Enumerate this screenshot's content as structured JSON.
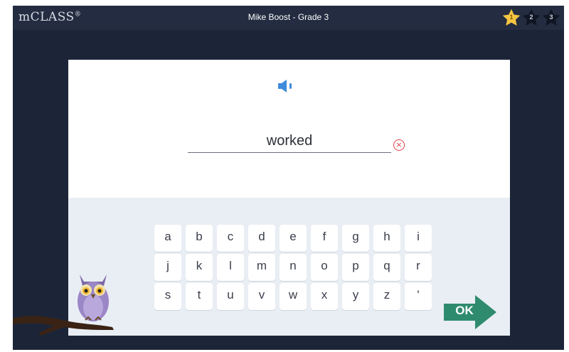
{
  "app": {
    "logo": "mCLASS",
    "logo_mark": "®",
    "title": "Mike Boost - Grade 3"
  },
  "stars": [
    {
      "number": "1",
      "earned": true
    },
    {
      "number": "2",
      "earned": false
    },
    {
      "number": "3",
      "earned": false
    }
  ],
  "answer": {
    "value": "worked"
  },
  "keyboard": {
    "rows": [
      [
        "a",
        "b",
        "c",
        "d",
        "e",
        "f",
        "g",
        "h",
        "i"
      ],
      [
        "j",
        "k",
        "l",
        "m",
        "n",
        "o",
        "p",
        "q",
        "r"
      ],
      [
        "s",
        "t",
        "u",
        "v",
        "w",
        "x",
        "y",
        "z",
        "'"
      ]
    ]
  },
  "ok_label": "OK",
  "colors": {
    "frame": "#1c2538",
    "accent": "#3e8bdc",
    "ok": "#2f8b6e",
    "star_earned": "#f5c542",
    "clear": "#e0434a"
  }
}
